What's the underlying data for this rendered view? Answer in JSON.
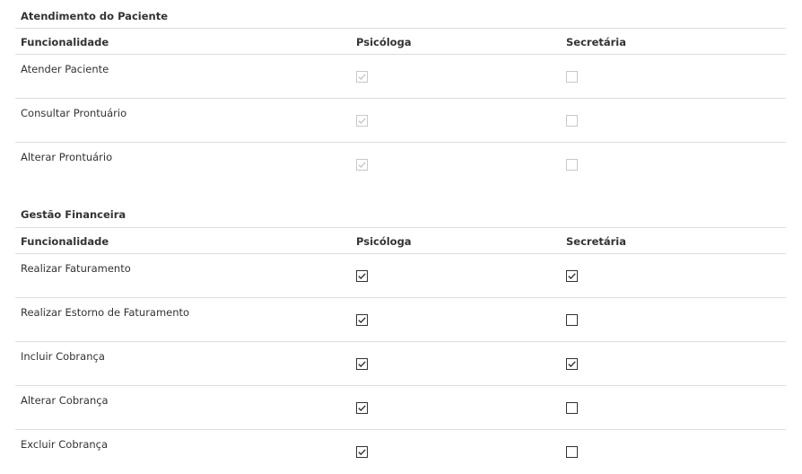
{
  "sections": [
    {
      "title": "Atendimento do Paciente",
      "headers": [
        "Funcionalidade",
        "Psicóloga",
        "Secretária"
      ],
      "rows": [
        {
          "label": "Atender Paciente",
          "psicologa": {
            "checked": true,
            "disabled": true
          },
          "secretaria": {
            "checked": false,
            "disabled": true
          }
        },
        {
          "label": "Consultar Prontuário",
          "psicologa": {
            "checked": true,
            "disabled": true
          },
          "secretaria": {
            "checked": false,
            "disabled": true
          }
        },
        {
          "label": "Alterar Prontuário",
          "psicologa": {
            "checked": true,
            "disabled": true
          },
          "secretaria": {
            "checked": false,
            "disabled": true
          }
        }
      ]
    },
    {
      "title": "Gestão Financeira",
      "headers": [
        "Funcionalidade",
        "Psicóloga",
        "Secretária"
      ],
      "rows": [
        {
          "label": "Realizar Faturamento",
          "psicologa": {
            "checked": true,
            "disabled": false
          },
          "secretaria": {
            "checked": true,
            "disabled": false
          }
        },
        {
          "label": "Realizar Estorno de Faturamento",
          "psicologa": {
            "checked": true,
            "disabled": false
          },
          "secretaria": {
            "checked": false,
            "disabled": false
          }
        },
        {
          "label": "Incluir Cobrança",
          "psicologa": {
            "checked": true,
            "disabled": false
          },
          "secretaria": {
            "checked": true,
            "disabled": false
          }
        },
        {
          "label": "Alterar Cobrança",
          "psicologa": {
            "checked": true,
            "disabled": false
          },
          "secretaria": {
            "checked": false,
            "disabled": false
          }
        },
        {
          "label": "Excluir Cobrança",
          "psicologa": {
            "checked": true,
            "disabled": false
          },
          "secretaria": {
            "checked": false,
            "disabled": false
          }
        }
      ]
    }
  ],
  "colors": {
    "border": "#dddddd",
    "text": "#333333",
    "checkbox_enabled": "#333333",
    "checkbox_disabled": "#c8c8c8"
  }
}
